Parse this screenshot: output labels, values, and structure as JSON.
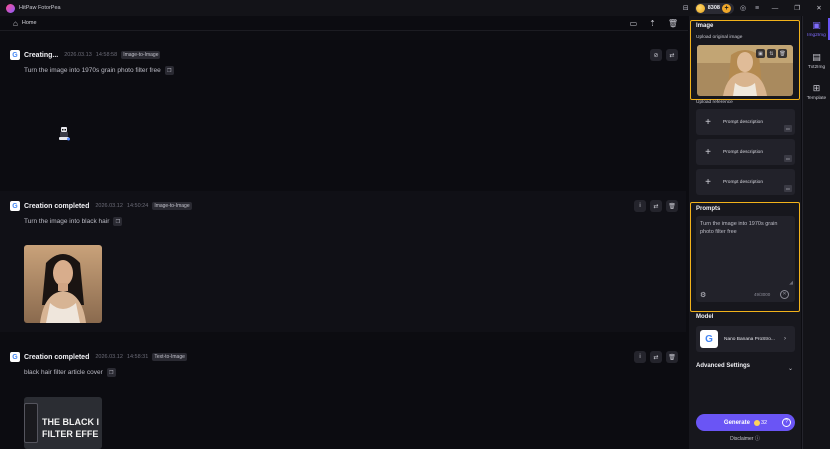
{
  "app": {
    "title": "HitPaw FotorPea",
    "credits": "8308"
  },
  "toolbar": {
    "home_label": "Home"
  },
  "feed": {
    "cards": [
      {
        "status": "Creating...",
        "date": "2026.03.13",
        "time": "14:58:58",
        "tag": "Image-to-Image",
        "prompt": "Turn the image into 1970s grain photo filter free"
      },
      {
        "status": "Creation completed",
        "date": "2026.03.12",
        "time": "14:50:24",
        "tag": "Image-to-Image",
        "prompt": "Turn the image into black hair"
      },
      {
        "status": "Creation completed",
        "date": "2026.03.12",
        "time": "14:58:31",
        "tag": "Text-to-Image",
        "prompt": "black hair filter article cover",
        "thumb_text_1": "THE BLACK I",
        "thumb_text_2": "FILTER EFFE"
      }
    ]
  },
  "panel": {
    "image_title": "Image",
    "upload_original": "Upload original image",
    "upload_reference": "Upload reference",
    "reference_slots": [
      "Prompt description",
      "Prompt description",
      "Prompt description"
    ],
    "prompts_title": "Prompts",
    "prompt_value": "Turn the image into 1970s grain photo filter free",
    "char_count": "49/3000",
    "model_title": "Model",
    "model_name": "Nano Banana ProStro...",
    "advanced_settings": "Advanced Settings",
    "generate_label": "Generate",
    "generate_cost": "32",
    "disclaimer": "Disclaimer"
  },
  "rail": {
    "items": [
      {
        "label": "Img2Img",
        "icon": "image-edit-icon",
        "active": true
      },
      {
        "label": "Txt2Img",
        "icon": "text-image-icon",
        "active": false
      },
      {
        "label": "Template",
        "icon": "template-grid-icon",
        "active": false
      }
    ]
  },
  "colors": {
    "accent": "#6a55f5",
    "highlight": "#f2b21b",
    "background": "#0c0c11",
    "panel": "#17171d"
  }
}
